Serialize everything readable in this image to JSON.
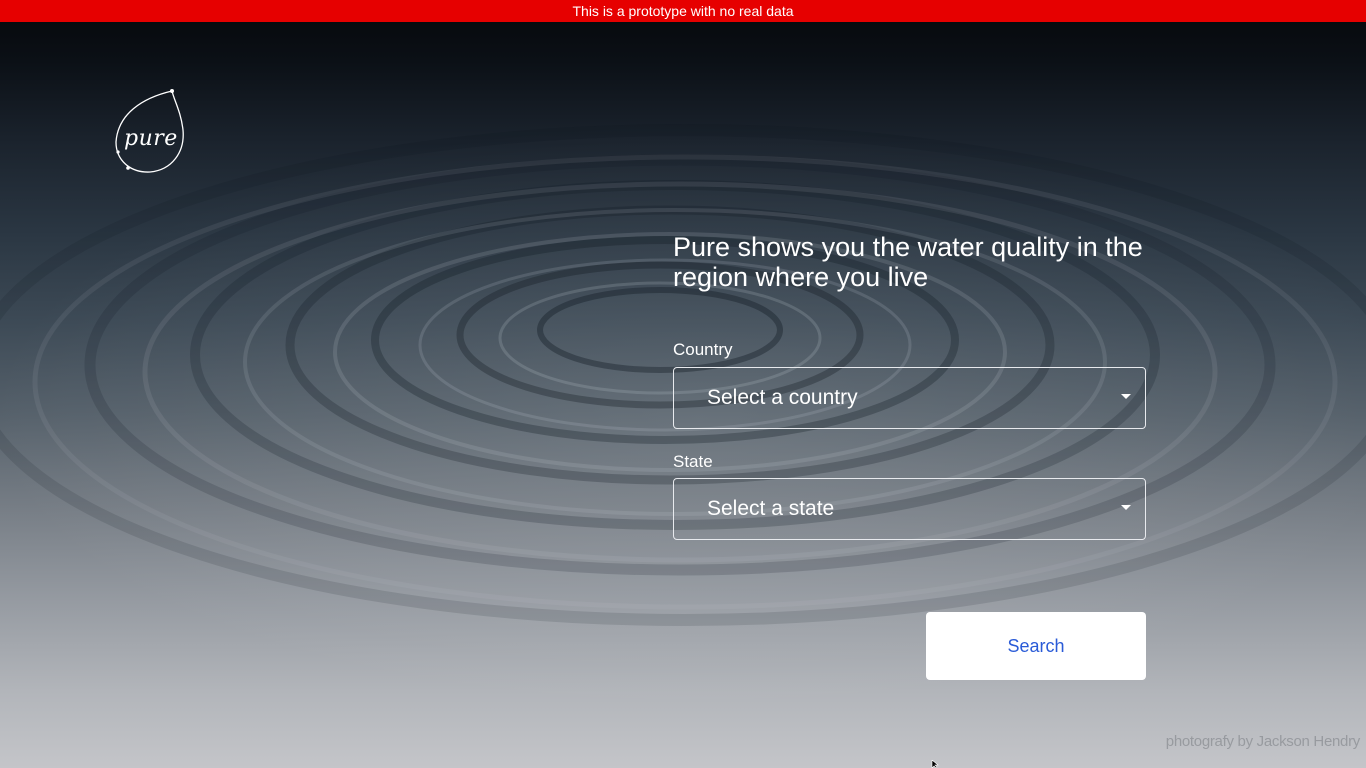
{
  "banner": {
    "text": "This is a prototype with no real data",
    "color": "#e60000"
  },
  "logo": {
    "text": "pure"
  },
  "hero": {
    "headline": "Pure shows you the water quality in the region where you live"
  },
  "form": {
    "country": {
      "label": "Country",
      "selected": "Select a country"
    },
    "state": {
      "label": "State",
      "selected": "Select a state"
    },
    "search_label": "Search"
  },
  "credit": {
    "text": "photografy by Jackson Hendry"
  },
  "colors": {
    "accent": "#2a5bd7",
    "banner": "#e60000",
    "text": "#ffffff"
  },
  "icons": [
    "leaf-drop-logo-icon",
    "caret-down-icon",
    "mouse-cursor-icon"
  ]
}
